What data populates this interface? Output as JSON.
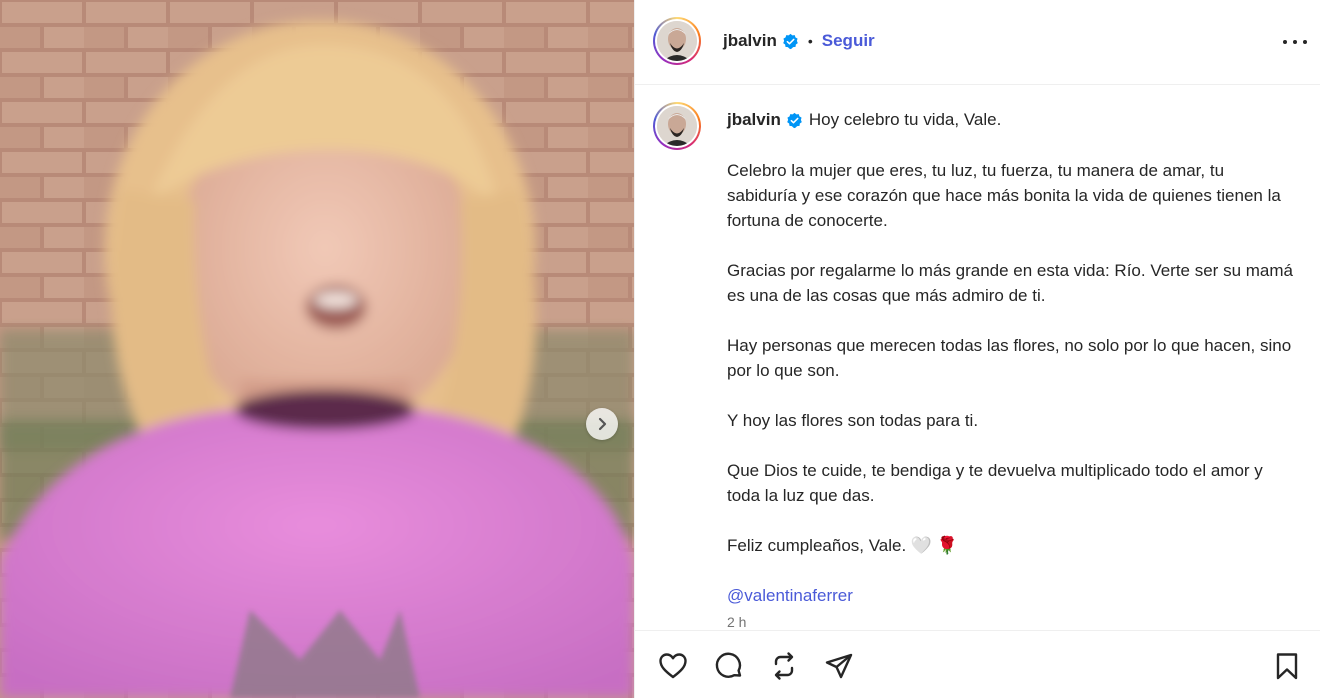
{
  "post": {
    "username": "jbalvin",
    "follow_label": "Seguir",
    "separator": "•",
    "caption_first_line": "Hoy celebro tu vida, Vale.",
    "caption_paragraphs": [
      "Celebro la mujer que eres, tu luz, tu fuerza, tu manera de amar, tu sabiduría y ese corazón que hace más bonita la vida de quienes tienen la fortuna de conocerte.",
      "Gracias por regalarme lo más grande en esta vida: Río. Verte ser su mamá es una de las cosas que más admiro de ti.",
      "Hay personas que merecen todas las flores, no solo por lo que hacen, sino por lo que son.",
      "Y hoy las flores son todas para ti.",
      "Que Dios te cuide, te bendiga y te devuelva multiplicado todo el amor y toda la luz que das.",
      "Feliz cumpleaños, Vale. 🤍 🌹"
    ],
    "mention": "@valentinaferrer",
    "time_ago": "2 h"
  },
  "icons": {
    "verified": "verified-badge-icon",
    "more": "more-options-icon",
    "next": "chevron-right-icon",
    "like": "heart-icon",
    "comment": "comment-icon",
    "repost": "repost-icon",
    "share": "send-icon",
    "save": "bookmark-icon"
  },
  "colors": {
    "link_blue": "#4a5ad8",
    "verified_blue": "#0095f6",
    "muted_text": "#737373",
    "border": "#efefef"
  }
}
